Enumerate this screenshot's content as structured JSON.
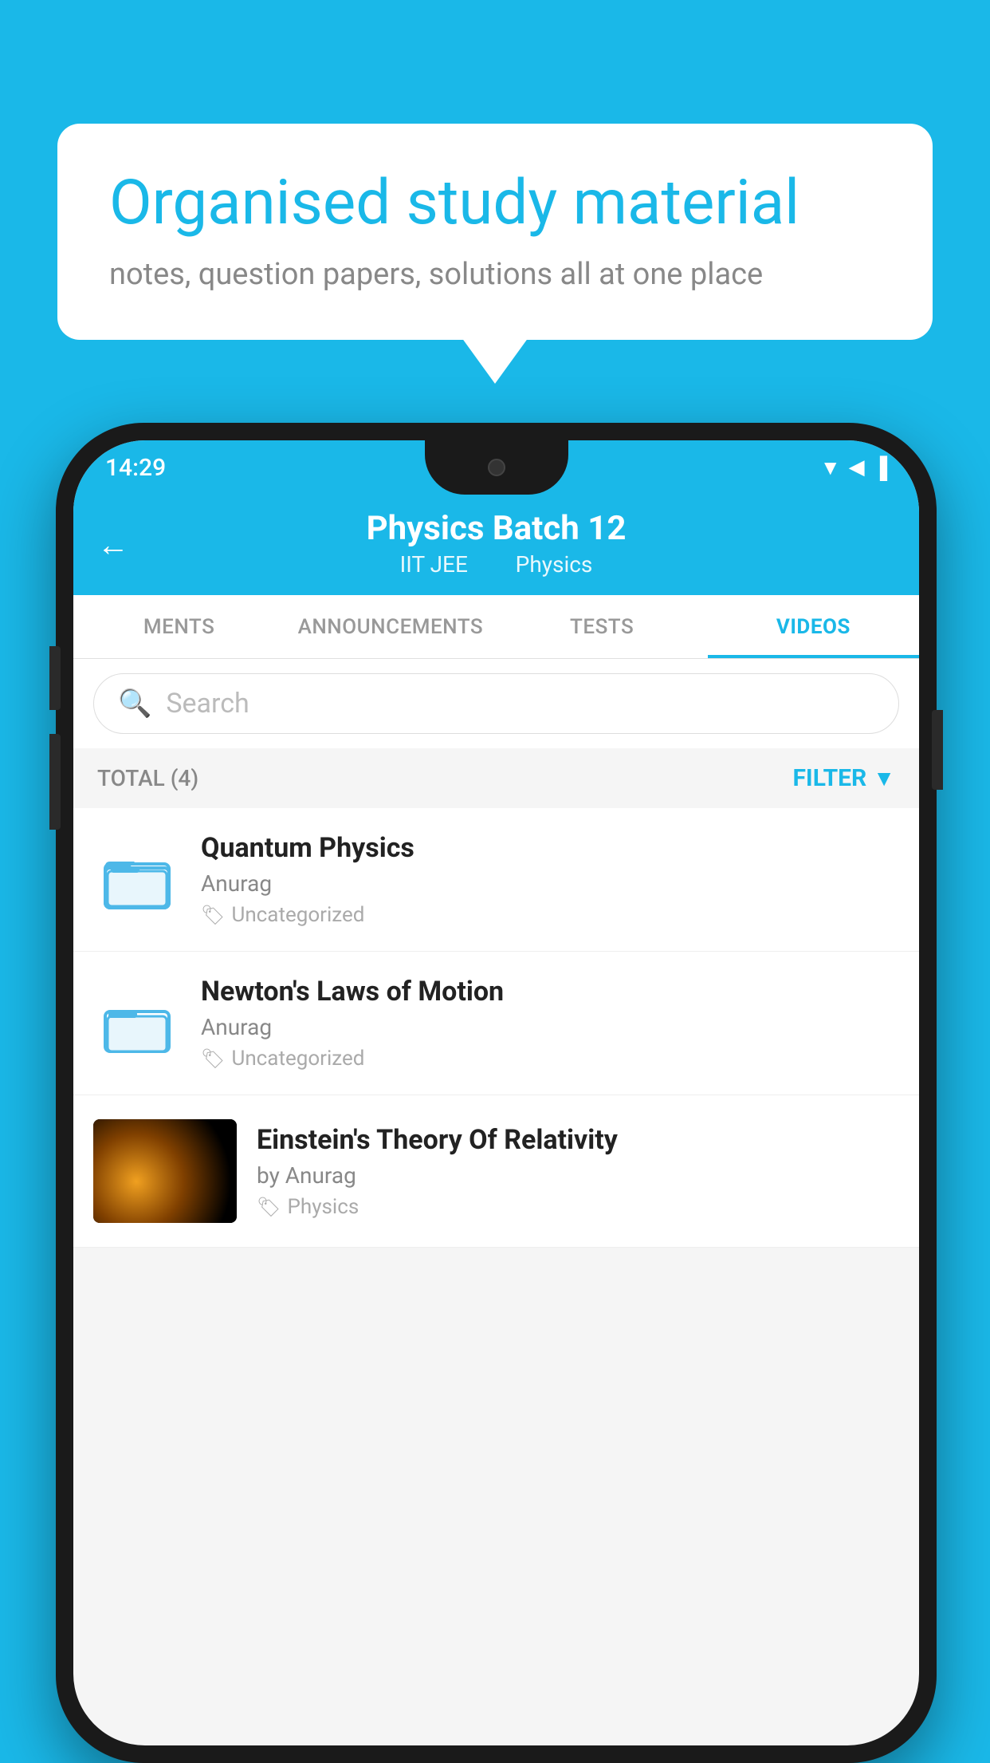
{
  "background": {
    "color": "#1ab8e8"
  },
  "speech_bubble": {
    "title": "Organised study material",
    "subtitle": "notes, question papers, solutions all at one place"
  },
  "phone": {
    "status_bar": {
      "time": "14:29",
      "icons": "▼◀▐"
    },
    "header": {
      "back_label": "←",
      "title": "Physics Batch 12",
      "subtitle_left": "IIT JEE",
      "subtitle_right": "Physics"
    },
    "tabs": [
      {
        "label": "MENTS",
        "active": false
      },
      {
        "label": "ANNOUNCEMENTS",
        "active": false
      },
      {
        "label": "TESTS",
        "active": false
      },
      {
        "label": "VIDEOS",
        "active": true
      }
    ],
    "search": {
      "placeholder": "Search"
    },
    "filter_row": {
      "total": "TOTAL (4)",
      "filter_label": "FILTER"
    },
    "videos": [
      {
        "id": "1",
        "title": "Quantum Physics",
        "author": "Anurag",
        "tag": "Uncategorized",
        "type": "folder",
        "has_thumbnail": false
      },
      {
        "id": "2",
        "title": "Newton's Laws of Motion",
        "author": "Anurag",
        "tag": "Uncategorized",
        "type": "folder",
        "has_thumbnail": false
      },
      {
        "id": "3",
        "title": "Einstein's Theory Of Relativity",
        "author": "by Anurag",
        "tag": "Physics",
        "type": "video",
        "has_thumbnail": true
      }
    ]
  }
}
